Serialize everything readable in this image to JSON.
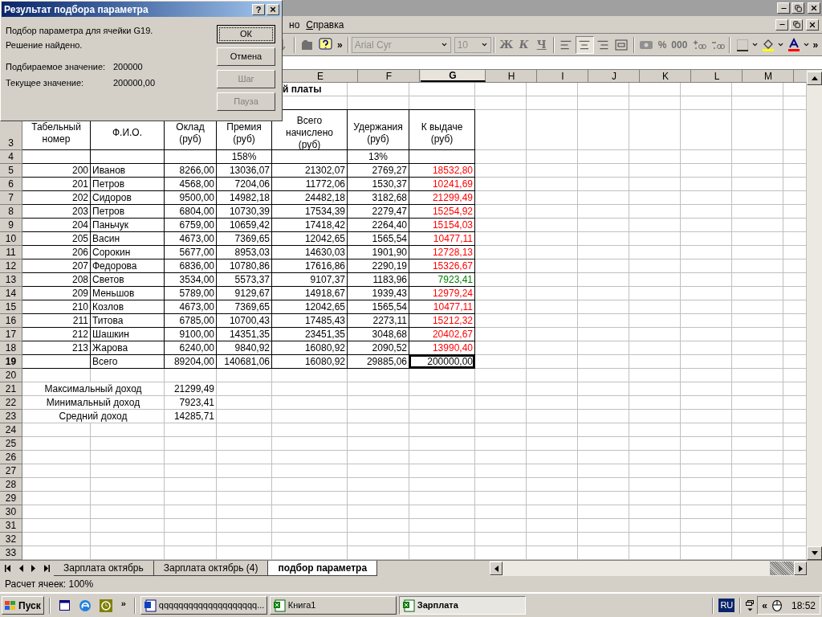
{
  "dialog": {
    "title": "Результат подбора параметра",
    "help_button": "?",
    "close_button": "×",
    "message": "Подбор параметра для ячейки G19.",
    "status": "Решение найдено.",
    "fields": [
      {
        "label": "Подбираемое значение:",
        "value": "200000"
      },
      {
        "label": "Текущее значение:",
        "value": "200000,00"
      }
    ],
    "buttons": [
      {
        "label": "ОК",
        "disabled": false,
        "default": true
      },
      {
        "label": "Отмена",
        "disabled": false,
        "default": false
      },
      {
        "label": "Шаг",
        "disabled": true,
        "default": false
      },
      {
        "label": "Пауза",
        "disabled": true,
        "default": false
      }
    ]
  },
  "menu": {
    "items": [
      "но",
      "Справка"
    ]
  },
  "toolbar": {
    "font": "Arial Cyr",
    "size": "10",
    "format_buttons": [
      "Ж",
      "К",
      "Ч"
    ],
    "align_buttons": [
      {
        "kind": "left",
        "selected": false
      },
      {
        "kind": "center",
        "selected": true
      },
      {
        "kind": "right",
        "selected": false
      },
      {
        "kind": "merge",
        "selected": false
      }
    ],
    "number_buttons": [
      "%",
      "000"
    ],
    "overflow": "»"
  },
  "column_headers": [
    {
      "label": "E",
      "selected": false
    },
    {
      "label": "F",
      "selected": false
    },
    {
      "label": "G",
      "selected": true
    },
    {
      "label": "H",
      "selected": false
    },
    {
      "label": "I",
      "selected": false
    },
    {
      "label": "J",
      "selected": false
    },
    {
      "label": "K",
      "selected": false
    },
    {
      "label": "L",
      "selected": false
    },
    {
      "label": "M",
      "selected": false
    }
  ],
  "title_fragment": "й платы",
  "header_row": {
    "number": "3",
    "headers": [
      "Табельный номер",
      "Ф.И.О.",
      "Оклад (руб)",
      "Премия (руб)",
      "Всего начислено (руб)",
      "Удержания (руб)",
      "К выдаче (руб)"
    ]
  },
  "percent_row": {
    "number": "4",
    "bonus_pct": "158%",
    "deduction_pct": "13%"
  },
  "employees": [
    {
      "number": "5",
      "tab_no": "200",
      "name": "Иванов",
      "salary": "8266,00",
      "bonus": "13036,07",
      "total": "21302,07",
      "deduction": "2769,27",
      "payout": "18532,80",
      "color": "#ff0000"
    },
    {
      "number": "6",
      "tab_no": "201",
      "name": "Петров",
      "salary": "4568,00",
      "bonus": "7204,06",
      "total": "11772,06",
      "deduction": "1530,37",
      "payout": "10241,69",
      "color": "#ff0000"
    },
    {
      "number": "7",
      "tab_no": "202",
      "name": "Сидоров",
      "salary": "9500,00",
      "bonus": "14982,18",
      "total": "24482,18",
      "deduction": "3182,68",
      "payout": "21299,49",
      "color": "#ff0000"
    },
    {
      "number": "8",
      "tab_no": "203",
      "name": "Петров",
      "salary": "6804,00",
      "bonus": "10730,39",
      "total": "17534,39",
      "deduction": "2279,47",
      "payout": "15254,92",
      "color": "#ff0000"
    },
    {
      "number": "9",
      "tab_no": "204",
      "name": "Паньчук",
      "salary": "6759,00",
      "bonus": "10659,42",
      "total": "17418,42",
      "deduction": "2264,40",
      "payout": "15154,03",
      "color": "#ff0000"
    },
    {
      "number": "10",
      "tab_no": "205",
      "name": "Васин",
      "salary": "4673,00",
      "bonus": "7369,65",
      "total": "12042,65",
      "deduction": "1565,54",
      "payout": "10477,11",
      "color": "#ff0000"
    },
    {
      "number": "11",
      "tab_no": "206",
      "name": "Сорокин",
      "salary": "5677,00",
      "bonus": "8953,03",
      "total": "14630,03",
      "deduction": "1901,90",
      "payout": "12728,13",
      "color": "#ff0000"
    },
    {
      "number": "12",
      "tab_no": "207",
      "name": "Федорова",
      "salary": "6836,00",
      "bonus": "10780,86",
      "total": "17616,86",
      "deduction": "2290,19",
      "payout": "15326,67",
      "color": "#ff0000"
    },
    {
      "number": "13",
      "tab_no": "208",
      "name": "Светов",
      "salary": "3534,00",
      "bonus": "5573,37",
      "total": "9107,37",
      "deduction": "1183,96",
      "payout": "7923,41",
      "color": "#008000"
    },
    {
      "number": "14",
      "tab_no": "209",
      "name": "Меньшов",
      "salary": "5789,00",
      "bonus": "9129,67",
      "total": "14918,67",
      "deduction": "1939,43",
      "payout": "12979,24",
      "color": "#ff0000"
    },
    {
      "number": "15",
      "tab_no": "210",
      "name": "Козлов",
      "salary": "4673,00",
      "bonus": "7369,65",
      "total": "12042,65",
      "deduction": "1565,54",
      "payout": "10477,11",
      "color": "#ff0000"
    },
    {
      "number": "16",
      "tab_no": "211",
      "name": "Титова",
      "salary": "6785,00",
      "bonus": "10700,43",
      "total": "17485,43",
      "deduction": "2273,11",
      "payout": "15212,32",
      "color": "#ff0000"
    },
    {
      "number": "17",
      "tab_no": "212",
      "name": "Шашкин",
      "salary": "9100,00",
      "bonus": "14351,35",
      "total": "23451,35",
      "deduction": "3048,68",
      "payout": "20402,67",
      "color": "#ff0000"
    },
    {
      "number": "18",
      "tab_no": "213",
      "name": "Жарова",
      "salary": "6240,00",
      "bonus": "9840,92",
      "total": "16080,92",
      "deduction": "2090,52",
      "payout": "13990,40",
      "color": "#ff0000"
    }
  ],
  "total_row": {
    "number": "19",
    "label": "Всего",
    "salary": "89204,00",
    "bonus": "140681,06",
    "total": "16080,92",
    "deduction": "29885,06",
    "payout": "200000,00",
    "selected": true
  },
  "blank_row": {
    "number": "20"
  },
  "summary": [
    {
      "number": "21",
      "label": "Максимальный доход",
      "value": "21299,49"
    },
    {
      "number": "22",
      "label": "Минимальный доход",
      "value": "7923,41"
    },
    {
      "number": "23",
      "label": "Средний доход",
      "value": "14285,71"
    }
  ],
  "empty_rows": [
    "24",
    "25",
    "26",
    "27",
    "28",
    "29",
    "30",
    "31",
    "32",
    "33"
  ],
  "sheet_tabs": [
    {
      "label": "Зарплата октябрь",
      "selected": false
    },
    {
      "label": "Зарплата октябрь (4)",
      "selected": false
    },
    {
      "label": "подбор параметра",
      "selected": true
    }
  ],
  "status_bar": "Расчет ячеек: 100%",
  "taskbar": {
    "start": "Пуск",
    "overflow": "»",
    "tasks": [
      {
        "label": "qqqqqqqqqqqqqqqqqqqq...",
        "kind": "word",
        "selected": false
      },
      {
        "label": "Книга1",
        "kind": "excel",
        "selected": false
      },
      {
        "label": "Зарплата",
        "kind": "excel",
        "selected": true
      }
    ],
    "language": "RU",
    "tray_expand": "«",
    "clock": "18:52"
  }
}
